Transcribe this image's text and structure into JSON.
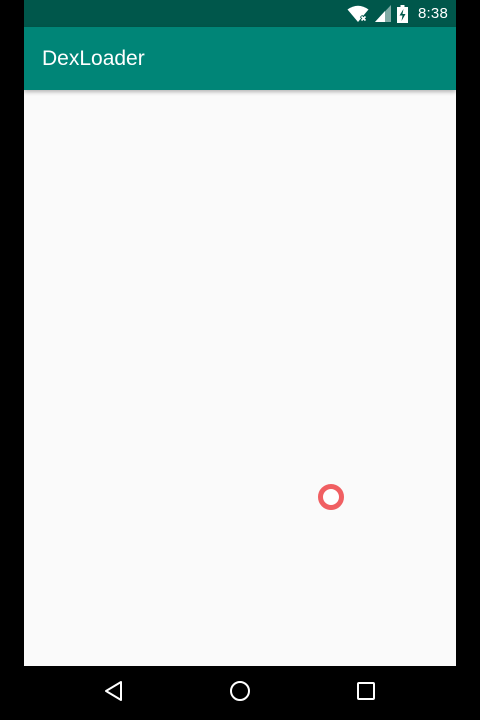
{
  "status_bar": {
    "time": "8:38",
    "icons": [
      "wifi-icon",
      "cellular-signal-icon",
      "battery-charging-icon"
    ],
    "background": "#00574b"
  },
  "app_bar": {
    "title": "DexLoader",
    "background": "#008577"
  },
  "content": {
    "background": "#fafafa"
  },
  "touch_indicator": {
    "color": "#f0575a"
  },
  "nav_bar": {
    "buttons": [
      "back-icon",
      "home-icon",
      "recents-icon"
    ]
  }
}
